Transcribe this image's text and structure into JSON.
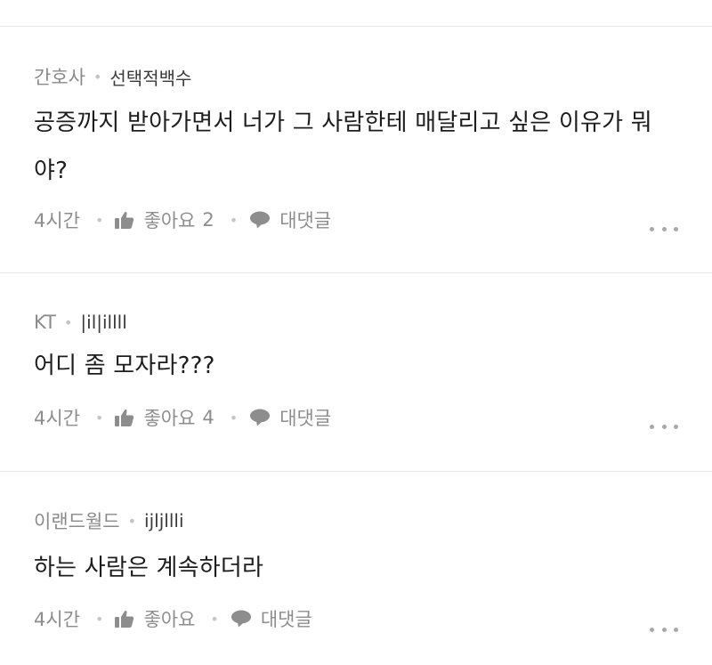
{
  "comments": [
    {
      "author": "간호사",
      "job": "선택적백수",
      "text": "공증까지 받아가면서 너가 그 사람한테 매달리고 싶은 이유가 뭐야?",
      "time": "4시간",
      "like_label": "좋아요",
      "like_count": "2",
      "reply_label": "대댓글"
    },
    {
      "author": "KT",
      "job": "|il|illll",
      "text": "어디 좀 모자라???",
      "time": "4시간",
      "like_label": "좋아요",
      "like_count": "4",
      "reply_label": "대댓글"
    },
    {
      "author": "이랜드월드",
      "job": "ijljllli",
      "text": "하는 사람은 계속하더라",
      "time": "4시간",
      "like_label": "좋아요",
      "like_count": "",
      "reply_label": "대댓글"
    }
  ],
  "icons": {
    "like": "thumbs-up-icon",
    "reply": "speech-bubble-icon",
    "more": "more-dots-icon"
  },
  "colors": {
    "author": "#8a8a8a",
    "body": "#1d1d1d",
    "meta": "#8d8d8d",
    "divider": "#e6e6e6"
  }
}
